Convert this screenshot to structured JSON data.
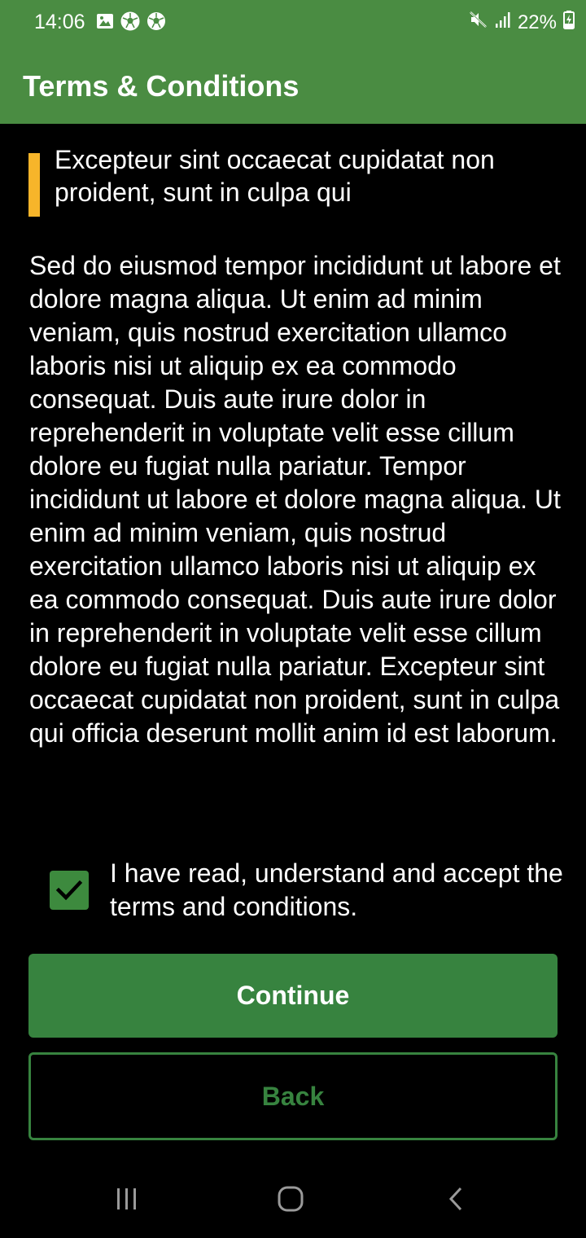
{
  "status_bar": {
    "time": "14:06",
    "battery": "22%",
    "left_icons": [
      "image-icon",
      "soccer-ball-icon",
      "soccer-ball-icon"
    ],
    "right_icons": [
      "mute-icon",
      "signal-icon",
      "battery-charging-icon"
    ]
  },
  "app_bar": {
    "title": "Terms & Conditions"
  },
  "content": {
    "quote": "Excepteur sint occaecat cupidatat non proident, sunt in culpa qui",
    "body": "Sed do eiusmod tempor incididunt ut labore et dolore magna aliqua. Ut enim ad minim veniam, quis nostrud exercitation ullamco laboris nisi ut aliquip ex ea commodo consequat. Duis aute irure dolor in reprehenderit in voluptate velit esse cillum dolore eu fugiat nulla pariatur. Tempor incididunt ut labore et dolore magna aliqua. Ut enim ad minim veniam, quis nostrud exercitation ullamco laboris nisi ut aliquip ex ea commodo consequat. Duis aute irure dolor in reprehenderit in voluptate velit esse cillum dolore eu fugiat nulla pariatur. Excepteur sint occaecat cupidatat non proident, sunt in culpa qui officia deserunt mollit anim id est laborum."
  },
  "consent": {
    "checked": true,
    "label": "I have read, understand and accept the terms and conditions."
  },
  "buttons": {
    "continue_label": "Continue",
    "back_label": "Back"
  },
  "colors": {
    "primary_green": "#37833f",
    "header_green": "#4a8c42",
    "quote_accent": "#f7b52a",
    "background": "#000000"
  },
  "nav_bar": {
    "icons": [
      "recent-apps-icon",
      "home-icon",
      "back-nav-icon"
    ]
  }
}
